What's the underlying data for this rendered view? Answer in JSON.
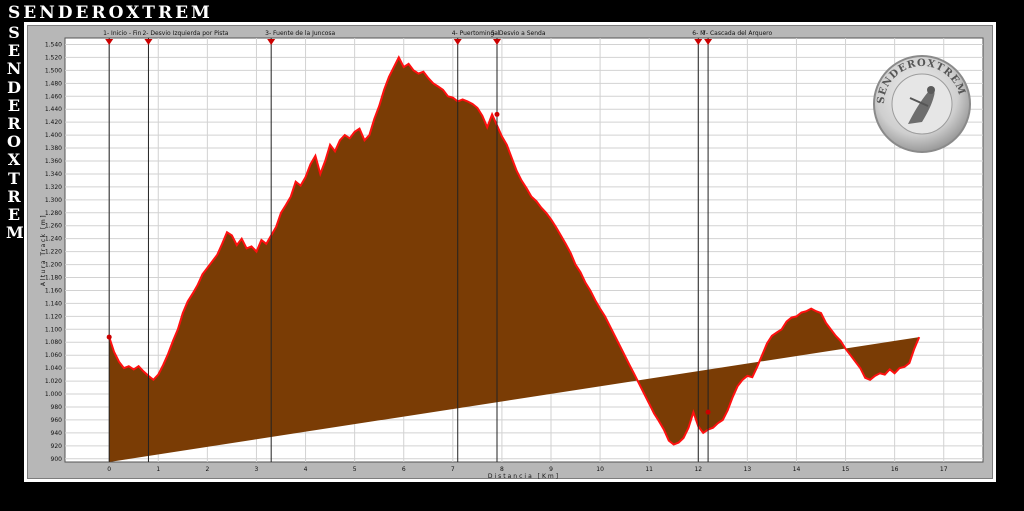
{
  "brand": {
    "name": "SENDEROXTREM",
    "side": "SENDEROXTREM"
  },
  "watermark": {
    "text": "SENDEROXTREM",
    "icon": "climber-seal-icon"
  },
  "colors": {
    "fill": "#7a3c05",
    "profile": "#ff1010",
    "marker": "#cc0000"
  },
  "chart_data": {
    "type": "area",
    "xlabel": "Distancia [Km]",
    "ylabel": "Altura Track [m]",
    "xlim": [
      -0.9,
      17.8
    ],
    "ylim": [
      895,
      1550
    ],
    "xticks": [
      0,
      1,
      2,
      3,
      4,
      5,
      6,
      7,
      8,
      9,
      10,
      11,
      12,
      13,
      14,
      15,
      16,
      17
    ],
    "yticks": [
      900,
      920,
      940,
      960,
      980,
      1000,
      1020,
      1040,
      1060,
      1080,
      1100,
      1120,
      1140,
      1160,
      1180,
      1200,
      1220,
      1240,
      1260,
      1280,
      1300,
      1320,
      1340,
      1360,
      1380,
      1400,
      1420,
      1440,
      1460,
      1480,
      1500,
      1520,
      1540
    ],
    "ytick_labels": [
      "900",
      "920",
      "940",
      "960",
      "980",
      "1.000",
      "1.020",
      "1.040",
      "1.060",
      "1.080",
      "1.100",
      "1.120",
      "1.140",
      "1.160",
      "1.180",
      "1.200",
      "1.220",
      "1.240",
      "1.260",
      "1.280",
      "1.300",
      "1.320",
      "1.340",
      "1.360",
      "1.380",
      "1.400",
      "1.420",
      "1.440",
      "1.460",
      "1.480",
      "1.500",
      "1.520",
      "1.540"
    ],
    "grid": true,
    "x": [
      0,
      0.1,
      0.2,
      0.3,
      0.4,
      0.5,
      0.6,
      0.7,
      0.8,
      0.9,
      1.0,
      1.1,
      1.2,
      1.3,
      1.4,
      1.5,
      1.6,
      1.7,
      1.8,
      1.9,
      2.0,
      2.1,
      2.2,
      2.3,
      2.4,
      2.5,
      2.6,
      2.7,
      2.8,
      2.9,
      3.0,
      3.1,
      3.2,
      3.3,
      3.4,
      3.5,
      3.6,
      3.7,
      3.8,
      3.9,
      4.0,
      4.1,
      4.2,
      4.3,
      4.4,
      4.5,
      4.6,
      4.7,
      4.8,
      4.9,
      5.0,
      5.1,
      5.2,
      5.3,
      5.4,
      5.5,
      5.6,
      5.7,
      5.8,
      5.9,
      6.0,
      6.1,
      6.2,
      6.3,
      6.4,
      6.5,
      6.6,
      6.7,
      6.8,
      6.9,
      7.0,
      7.1,
      7.2,
      7.3,
      7.4,
      7.5,
      7.6,
      7.7,
      7.8,
      7.9,
      8.0,
      8.1,
      8.2,
      8.3,
      8.4,
      8.5,
      8.6,
      8.7,
      8.8,
      8.9,
      9.0,
      9.1,
      9.2,
      9.3,
      9.4,
      9.5,
      9.6,
      9.7,
      9.8,
      9.9,
      10.0,
      10.1,
      10.2,
      10.3,
      10.4,
      10.5,
      10.6,
      10.7,
      10.8,
      10.9,
      11.0,
      11.1,
      11.2,
      11.3,
      11.4,
      11.5,
      11.6,
      11.7,
      11.8,
      11.9,
      12.0,
      12.1,
      12.2,
      12.3,
      12.4,
      12.5,
      12.6,
      12.7,
      12.8,
      12.9,
      13.0,
      13.1,
      13.2,
      13.3,
      13.4,
      13.5,
      13.6,
      13.7,
      13.8,
      13.9,
      14.0,
      14.1,
      14.2,
      14.3,
      14.4,
      14.5,
      14.6,
      14.7,
      14.8,
      14.9,
      15.0,
      15.1,
      15.2,
      15.3,
      15.4,
      15.5,
      15.6,
      15.7,
      15.8,
      15.9,
      16.0,
      16.1,
      16.2,
      16.3,
      16.4,
      16.5,
      16.6,
      16.7,
      16.8,
      16.9,
      17.0
    ],
    "series": [
      {
        "values": [
          1088,
          1065,
          1050,
          1040,
          1043,
          1038,
          1043,
          1035,
          1028,
          1022,
          1030,
          1045,
          1062,
          1082,
          1100,
          1125,
          1143,
          1155,
          1168,
          1185,
          1195,
          1205,
          1215,
          1232,
          1250,
          1245,
          1230,
          1240,
          1225,
          1228,
          1220,
          1238,
          1232,
          1245,
          1258,
          1280,
          1292,
          1305,
          1328,
          1322,
          1335,
          1355,
          1368,
          1340,
          1360,
          1385,
          1375,
          1392,
          1400,
          1395,
          1405,
          1410,
          1392,
          1400,
          1425,
          1445,
          1470,
          1490,
          1505,
          1520,
          1505,
          1510,
          1500,
          1495,
          1498,
          1488,
          1480,
          1475,
          1470,
          1460,
          1458,
          1452,
          1455,
          1452,
          1448,
          1442,
          1430,
          1412,
          1432,
          1415,
          1398,
          1385,
          1365,
          1345,
          1330,
          1318,
          1305,
          1298,
          1288,
          1280,
          1270,
          1258,
          1245,
          1232,
          1218,
          1200,
          1188,
          1172,
          1160,
          1145,
          1132,
          1120,
          1105,
          1090,
          1075,
          1060,
          1045,
          1030,
          1015,
          1000,
          985,
          970,
          958,
          945,
          928,
          922,
          925,
          932,
          948,
          972,
          950,
          940,
          945,
          948,
          955,
          960,
          975,
          995,
          1012,
          1022,
          1028,
          1026,
          1042,
          1060,
          1078,
          1090,
          1095,
          1100,
          1112,
          1118,
          1120,
          1126,
          1128,
          1132,
          1128,
          1125,
          1110,
          1100,
          1090,
          1082,
          1070,
          1060,
          1050,
          1040,
          1025,
          1022,
          1028,
          1032,
          1030,
          1038,
          1032,
          1040,
          1042,
          1048,
          1070,
          1088
        ]
      }
    ],
    "waypoints": [
      {
        "x": 0.0,
        "label": "1- Inicio - Fin"
      },
      {
        "x": 0.8,
        "label": "2- Desvio Izquierda por Pista"
      },
      {
        "x": 3.3,
        "label": "3- Fuente de la Juncosa"
      },
      {
        "x": 7.1,
        "label": "4- Puertomingal"
      },
      {
        "x": 7.9,
        "label": "5- Desvio a Senda"
      },
      {
        "x": 12.0,
        "label": "6- M"
      },
      {
        "x": 12.2,
        "label": "7- Cascada del Arquero"
      }
    ],
    "point_markers": [
      {
        "x": 0.0,
        "y": 1088
      },
      {
        "x": 7.9,
        "y": 1432
      },
      {
        "x": 12.2,
        "y": 972
      }
    ]
  }
}
